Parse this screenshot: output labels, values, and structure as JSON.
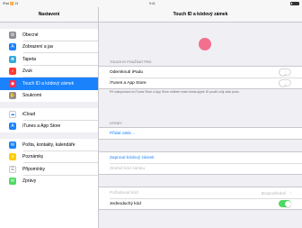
{
  "status": {
    "left": "iPad 🛜 13",
    "time": "9:41"
  },
  "sidebar": {
    "title": "Nastavení",
    "groups": [
      [
        {
          "label": "Obecné",
          "icon": "gear-icon",
          "color": "#8e8e93",
          "glyph": "⚙"
        },
        {
          "label": "Zobrazení a jas",
          "icon": "brightness-icon",
          "color": "#1a82fb",
          "glyph": "A"
        },
        {
          "label": "Tapeta",
          "icon": "wallpaper-icon",
          "color": "#34aadc",
          "glyph": "❀"
        },
        {
          "label": "Zvuk",
          "icon": "sound-icon",
          "color": "#ff3b30",
          "glyph": "♪"
        },
        {
          "label": "Touch ID a kódový zámek",
          "icon": "fingerprint-icon",
          "color": "#ff2d55",
          "glyph": "◉",
          "active": true
        },
        {
          "label": "Soukromí",
          "icon": "hand-icon",
          "color": "#8e8e93",
          "glyph": "✋"
        }
      ],
      [
        {
          "label": "iCloud",
          "icon": "cloud-icon",
          "color": "#ffffff",
          "glyph": "☁",
          "glyph_color": "#1a82fb"
        },
        {
          "label": "iTunes a App Store",
          "icon": "app-store-icon",
          "color": "#1a82fb",
          "glyph": "A"
        }
      ],
      [
        {
          "label": "Pošta, kontakty, kalendáře",
          "icon": "mail-icon",
          "color": "#1a82fb",
          "glyph": "✉"
        },
        {
          "label": "Poznámky",
          "icon": "notes-icon",
          "color": "#ffcc00",
          "glyph": "≡"
        },
        {
          "label": "Připomínky",
          "icon": "reminders-icon",
          "color": "#ffffff",
          "glyph": "☰",
          "glyph_color": "#8e8e93"
        },
        {
          "label": "Zprávy",
          "icon": "messages-icon",
          "color": "#4cd964",
          "glyph": "✉"
        }
      ]
    ]
  },
  "main": {
    "title": "Touch ID a kódový zámek",
    "section_touch": "TOUCH ID POUŽÍVAT PRO",
    "unlock_label": "Odemknutí iPadu",
    "itunes_label": "iTunes a App Store",
    "touch_footnote": "Při nakupování na iTunes Store a App Store můžete místo hesla Apple ID použít svůj otisk prstu.",
    "section_fingerprints": "OTISKY",
    "add_fingerprint": "Přidat otisk…",
    "turn_on_passcode": "Zapnout kódový zámek",
    "change_passcode": "Změnit kód zámku",
    "require_passcode_label": "Požadovat kód",
    "require_passcode_value": "Bezprostředně",
    "simple_passcode_label": "Jednoduchý kód"
  }
}
